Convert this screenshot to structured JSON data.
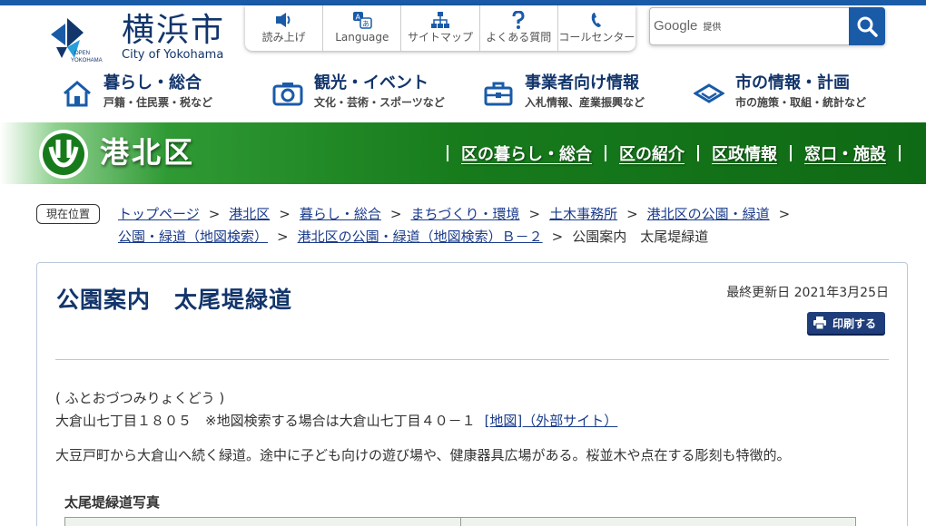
{
  "colors": {
    "brand_blue": "#1a5ba8",
    "navy": "#12356b",
    "ward_green": "#177b1c"
  },
  "header": {
    "logo_title": "横浜市",
    "logo_sub": "City of Yokohama",
    "logo_mark_text": "OPEN YOKOHAMA",
    "tools": [
      {
        "label": "読み上げ",
        "icon": "speaker-icon"
      },
      {
        "label": "Language",
        "icon": "language-icon"
      },
      {
        "label": "サイトマップ",
        "icon": "sitemap-icon"
      },
      {
        "label": "よくある質問",
        "icon": "question-icon"
      },
      {
        "label": "コールセンター",
        "icon": "phone-icon"
      }
    ],
    "search": {
      "brand": "Google",
      "brand_suffix": "提供",
      "icon": "search-icon"
    }
  },
  "mainnav": [
    {
      "title": "暮らし・総合",
      "sub": "戸籍・住民票・税など",
      "icon": "house-icon"
    },
    {
      "title": "観光・イベント",
      "sub": "文化・芸術・スポーツなど",
      "icon": "camera-icon"
    },
    {
      "title": "事業者向け情報",
      "sub": "入札情報、産業振興など",
      "icon": "briefcase-icon"
    },
    {
      "title": "市の情報・計画",
      "sub": "市の施策・取組・統計など",
      "icon": "building-icon"
    }
  ],
  "ward": {
    "name": "港北区",
    "links": [
      "区の暮らし・総合",
      "区の紹介",
      "区政情報",
      "窓口・施設"
    ]
  },
  "breadcrumb": {
    "badge": "現在位置",
    "items": [
      "トップページ",
      "港北区",
      "暮らし・総合",
      "まちづくり・環境",
      "土木事務所",
      "港北区の公園・緑道",
      "公園・緑道（地図検索）",
      "港北区の公園・緑道（地図検索）Ｂ－２"
    ],
    "current": "公園案内　太尾堤緑道"
  },
  "content": {
    "title": "公園案内　太尾堤緑道",
    "updated": "最終更新日 2021年3月25日",
    "print_label": "印刷する",
    "reading": "( ふとおづつみりょくどう )",
    "address": "大倉山七丁目１８０５　※地図検索する場合は大倉山七丁目４０－１",
    "map_link": "[地図]（外部サイト）",
    "description": "大豆戸町から大倉山へ続く緑道。途中に子ども向けの遊び場や、健康器具広場がある。桜並木や点在する彫刻も特徴的。",
    "photo_heading": "太尾堤緑道写真"
  }
}
